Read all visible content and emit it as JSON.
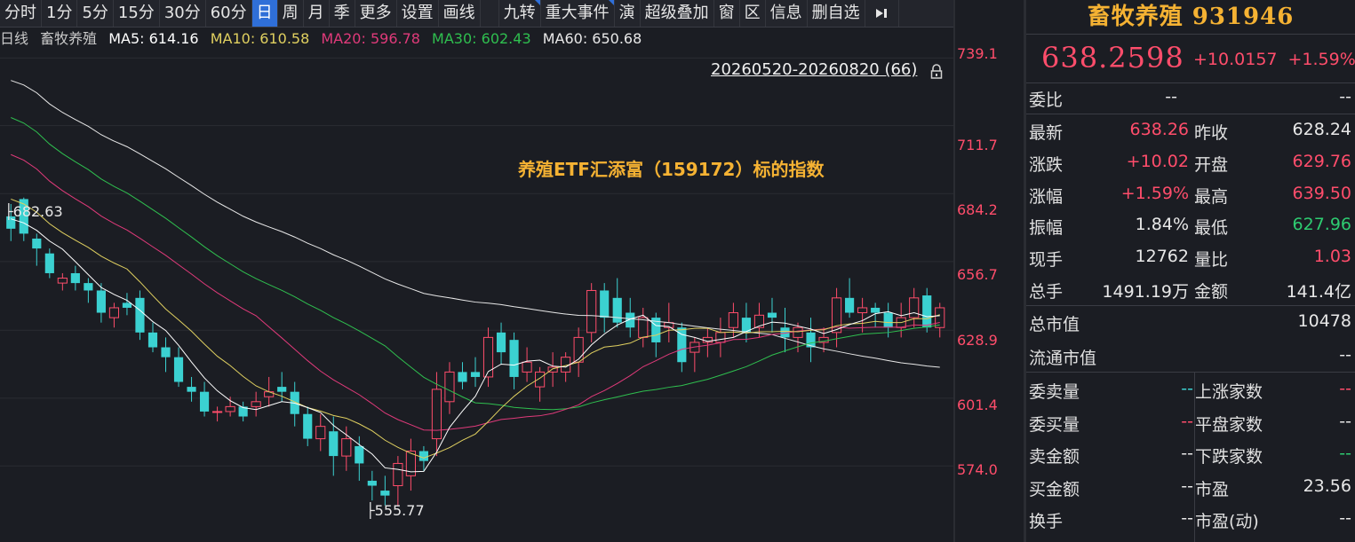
{
  "toolbar": {
    "items": [
      "分时",
      "1分",
      "5分",
      "15分",
      "30分",
      "60分",
      "日",
      "周",
      "月",
      "季",
      "更多",
      "设置",
      "画线",
      "九转",
      "重大事件",
      "演",
      "超级叠加",
      "窗",
      "区",
      "信息",
      "删自选"
    ],
    "active": "日"
  },
  "ma_line": {
    "period": "日线",
    "name": "畜牧养殖",
    "ma5": "MA5: 614.16",
    "ma10": "MA10: 610.58",
    "ma20": "MA20: 596.78",
    "ma30": "MA30: 602.43",
    "ma60": "MA60: 650.68"
  },
  "range_label": "20260520-20260820 (66)",
  "annotation": "养殖ETF汇添富（159172）标的指数",
  "price_axis": [
    "739.1",
    "711.7",
    "684.2",
    "656.7",
    "628.9",
    "601.4",
    "574.0"
  ],
  "high_tag": "682.63",
  "low_tag": "555.77",
  "colors": {
    "up": "#ff4d6b",
    "down": "#3bd1d1",
    "ma5": "#ffffff",
    "ma10": "#e0d060",
    "ma20": "#e03a7a",
    "ma30": "#2fbf4f",
    "ma60": "#e8e8e8",
    "accent": "#f5b233"
  },
  "chart_data": {
    "type": "candlestick",
    "ylim": [
      545,
      750
    ],
    "candles": [
      [
        675,
        680,
        665,
        670
      ],
      [
        682,
        682.6,
        665,
        668
      ],
      [
        666,
        668,
        655,
        662
      ],
      [
        660,
        662,
        650,
        652
      ],
      [
        648,
        652,
        645,
        650
      ],
      [
        652,
        655,
        645,
        648
      ],
      [
        648,
        650,
        640,
        645
      ],
      [
        645,
        648,
        632,
        636
      ],
      [
        634,
        640,
        630,
        638
      ],
      [
        640,
        644,
        635,
        638
      ],
      [
        642,
        645,
        625,
        628
      ],
      [
        628,
        632,
        620,
        622
      ],
      [
        622,
        626,
        612,
        618
      ],
      [
        618,
        622,
        606,
        608
      ],
      [
        606,
        610,
        600,
        604
      ],
      [
        604,
        608,
        594,
        596
      ],
      [
        596,
        598,
        592,
        596
      ],
      [
        596,
        602,
        594,
        598
      ],
      [
        598,
        600,
        592,
        594
      ],
      [
        598,
        604,
        594,
        600
      ],
      [
        602,
        610,
        598,
        604
      ],
      [
        606,
        612,
        600,
        604
      ],
      [
        604,
        608,
        590,
        595
      ],
      [
        595,
        598,
        582,
        585
      ],
      [
        585,
        595,
        580,
        590
      ],
      [
        588,
        594,
        570,
        578
      ],
      [
        578,
        590,
        572,
        585
      ],
      [
        582,
        586,
        568,
        575
      ],
      [
        568,
        572,
        560,
        566
      ],
      [
        564,
        570,
        558,
        562
      ],
      [
        566,
        578,
        558,
        575
      ],
      [
        570,
        585,
        564,
        580
      ],
      [
        580,
        582,
        572,
        576
      ],
      [
        585,
        612,
        578,
        605
      ],
      [
        600,
        616,
        595,
        612
      ],
      [
        612,
        616,
        605,
        608
      ],
      [
        612,
        618,
        606,
        610
      ],
      [
        610,
        630,
        606,
        626
      ],
      [
        628,
        632,
        615,
        620
      ],
      [
        625,
        628,
        605,
        610
      ],
      [
        612,
        622,
        608,
        616
      ],
      [
        606,
        614,
        600,
        612
      ],
      [
        612,
        620,
        606,
        614
      ],
      [
        612,
        620,
        608,
        618
      ],
      [
        616,
        630,
        610,
        626
      ],
      [
        628,
        648,
        624,
        645
      ],
      [
        645,
        648,
        628,
        634
      ],
      [
        642,
        650,
        630,
        632
      ],
      [
        636,
        642,
        626,
        630
      ],
      [
        626,
        638,
        622,
        634
      ],
      [
        634,
        636,
        618,
        624
      ],
      [
        630,
        640,
        624,
        632
      ],
      [
        630,
        632,
        612,
        616
      ],
      [
        620,
        626,
        612,
        624
      ],
      [
        624,
        630,
        618,
        626
      ],
      [
        624,
        634,
        618,
        628
      ],
      [
        630,
        640,
        626,
        636
      ],
      [
        634,
        640,
        624,
        628
      ],
      [
        630,
        640,
        626,
        635
      ],
      [
        636,
        642,
        628,
        634
      ],
      [
        630,
        638,
        620,
        626
      ],
      [
        626,
        632,
        620,
        630
      ],
      [
        628,
        634,
        616,
        622
      ],
      [
        624,
        630,
        620,
        626
      ],
      [
        628,
        646,
        622,
        642
      ],
      [
        642,
        650,
        634,
        636
      ],
      [
        636,
        642,
        628,
        638
      ],
      [
        638,
        640,
        630,
        636
      ],
      [
        636,
        640,
        626,
        630
      ],
      [
        630,
        640,
        626,
        634
      ],
      [
        634,
        646,
        630,
        642
      ],
      [
        643,
        646,
        628,
        630
      ],
      [
        630,
        640,
        626,
        638
      ]
    ]
  },
  "panel": {
    "title": "畜牧养殖 931946",
    "price": "638.2598",
    "change": "+10.0157",
    "change_pct": "+1.59%",
    "weibi_label": "委比",
    "weibi_val1": "--",
    "weibi_val2": "--",
    "rows": [
      {
        "l1": "最新",
        "v1": "638.26",
        "c1": "red",
        "l2": "昨收",
        "v2": "628.24",
        "c2": "white"
      },
      {
        "l1": "涨跌",
        "v1": "+10.02",
        "c1": "red",
        "l2": "开盘",
        "v2": "629.76",
        "c2": "red"
      },
      {
        "l1": "涨幅",
        "v1": "+1.59%",
        "c1": "red",
        "l2": "最高",
        "v2": "639.50",
        "c2": "red"
      },
      {
        "l1": "振幅",
        "v1": "1.84%",
        "c1": "white",
        "l2": "最低",
        "v2": "627.96",
        "c2": "green"
      },
      {
        "l1": "现手",
        "v1": "12762",
        "c1": "white",
        "l2": "量比",
        "v2": "1.03",
        "c2": "red"
      },
      {
        "l1": "总手",
        "v1": "1491.19万",
        "c1": "white",
        "l2": "金额",
        "v2": "141.4亿",
        "c2": "white"
      }
    ],
    "cap_label": "总市值",
    "cap_val": "10478",
    "float_label": "流通市值",
    "float_val": "--",
    "bottom_rows": [
      {
        "l1": "委卖量",
        "v1": "--",
        "c1": "cyan",
        "l2": "上涨家数",
        "v2": "--",
        "c2": "red"
      },
      {
        "l1": "委买量",
        "v1": "--",
        "c1": "red",
        "l2": "平盘家数",
        "v2": "--",
        "c2": "white"
      },
      {
        "l1": "卖金额",
        "v1": "--",
        "c1": "white",
        "l2": "下跌家数",
        "v2": "--",
        "c2": "green"
      },
      {
        "l1": "买金额",
        "v1": "--",
        "c1": "white",
        "l2": "市盈",
        "v2": "23.56",
        "c2": "white"
      },
      {
        "l1": "换手",
        "v1": "--",
        "c1": "white",
        "l2": "市盈(动)",
        "v2": "--",
        "c2": "white"
      }
    ]
  }
}
